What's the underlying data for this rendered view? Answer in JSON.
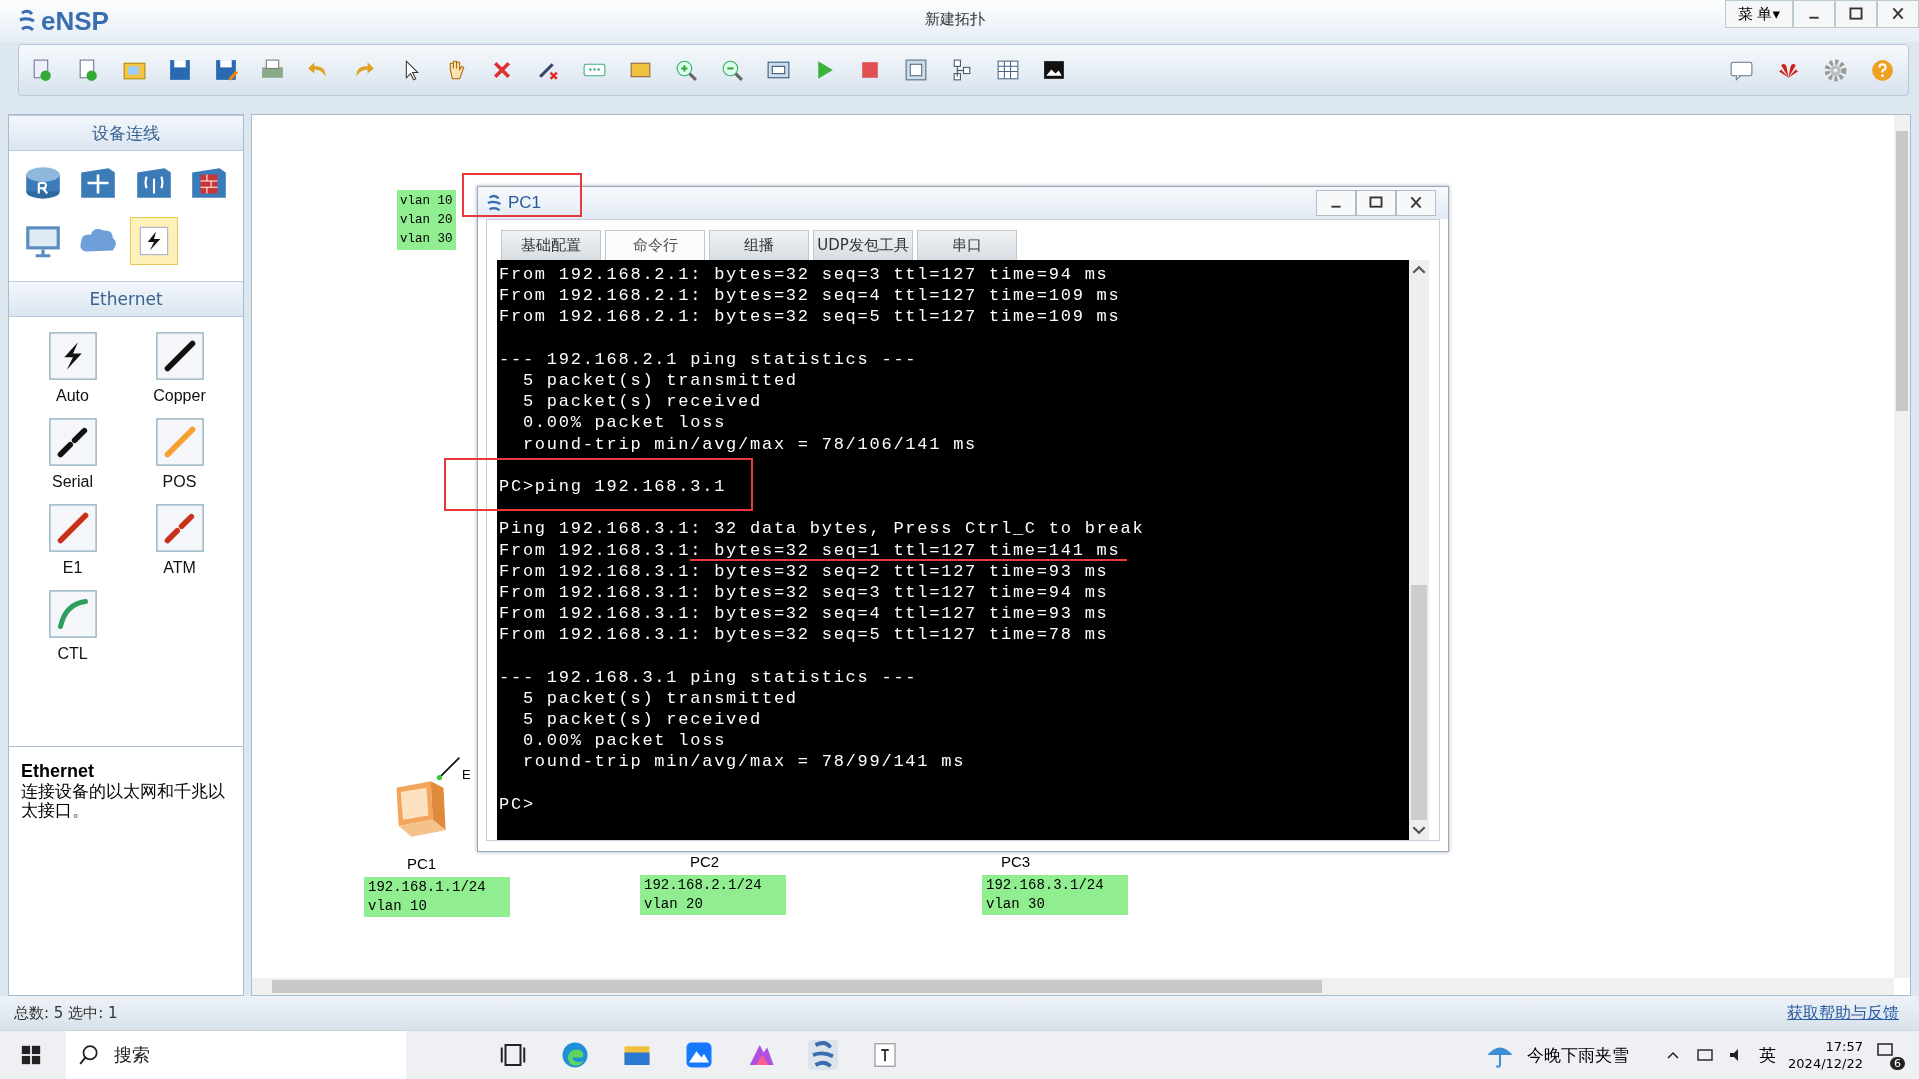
{
  "app": {
    "logo": "eNSP",
    "title": "新建拓扑",
    "menu": "菜 单▾"
  },
  "left_panel": {
    "devices_header": "设备连线",
    "device_types": [
      {
        "kind": "router",
        "selected": false
      },
      {
        "kind": "switch",
        "selected": false
      },
      {
        "kind": "wireless",
        "selected": false
      },
      {
        "kind": "firewall",
        "selected": false
      },
      {
        "kind": "pc",
        "selected": false
      },
      {
        "kind": "cloud",
        "selected": false
      },
      {
        "kind": "cable",
        "selected": true
      }
    ],
    "cables_header": "Ethernet",
    "cables": [
      {
        "label": "Auto",
        "kind": "auto",
        "color": "#111111"
      },
      {
        "label": "Copper",
        "kind": "solid",
        "color": "#111111"
      },
      {
        "label": "Serial",
        "kind": "dashed",
        "color": "#111111"
      },
      {
        "label": "POS",
        "kind": "solid",
        "color": "#f7a032"
      },
      {
        "label": "E1",
        "kind": "solid",
        "color": "#c8321a"
      },
      {
        "label": "ATM",
        "kind": "dashed",
        "color": "#c8321a"
      },
      {
        "label": "CTL",
        "kind": "curve",
        "color": "#2e9e5e"
      }
    ],
    "description": {
      "title": "Ethernet",
      "text": "连接设备的以太网和千兆以太接口。"
    }
  },
  "canvas": {
    "top_label": [
      "vlan 10",
      "vlan 20",
      "vlan 30"
    ],
    "link_label": "E",
    "pcs": [
      {
        "name": "PC1",
        "lines": [
          "192.168.1.1/24",
          "vlan 10"
        ]
      },
      {
        "name": "PC2",
        "lines": [
          "192.168.2.1/24",
          "vlan 20"
        ]
      },
      {
        "name": "PC3",
        "lines": [
          "192.168.3.1/24",
          "vlan 30"
        ]
      }
    ]
  },
  "pc_window": {
    "title": "PC1",
    "tabs": [
      {
        "label": "基础配置",
        "selected": false
      },
      {
        "label": "命令行",
        "selected": true
      },
      {
        "label": "组播",
        "selected": false
      },
      {
        "label": "UDP发包工具",
        "selected": false
      },
      {
        "label": "串口",
        "selected": false
      }
    ],
    "console": [
      [
        "From 192.168.2.1: bytes=32 seq=3 ttl=127 time=94 ms",
        "From 192.168.2.1: bytes=32 seq=4 ttl=127 time=109 ms",
        "From 192.168.2.1: bytes=32 seq=5 ttl=127 time=109 ms"
      ],
      [
        "--- 192.168.2.1 ping statistics ---",
        "  5 packet(s) transmitted",
        "  5 packet(s) received",
        "  0.00% packet loss",
        "  round-trip min/avg/max = 78/106/141 ms"
      ],
      [
        "PC>ping 192.168.3.1"
      ],
      [
        "Ping 192.168.3.1: 32 data bytes, Press Ctrl_C to break",
        "From 192.168.3.1: bytes=32 seq=1 ttl=127 time=141 ms",
        "From 192.168.3.1: bytes=32 seq=2 ttl=127 time=93 ms",
        "From 192.168.3.1: bytes=32 seq=3 ttl=127 time=94 ms",
        "From 192.168.3.1: bytes=32 seq=4 ttl=127 time=93 ms",
        "From 192.168.3.1: bytes=32 seq=5 ttl=127 time=78 ms"
      ],
      [
        "--- 192.168.3.1 ping statistics ---",
        "  5 packet(s) transmitted",
        "  5 packet(s) received",
        "  0.00% packet loss",
        "  round-trip min/avg/max = 78/99/141 ms"
      ],
      [
        "PC>"
      ]
    ]
  },
  "status_bar": {
    "summary": "总数: 5 选中: 1",
    "help_link": "获取帮助与反馈"
  },
  "taskbar": {
    "search": "搜索",
    "weather": "今晚下雨夹雪",
    "ime": "英",
    "time": "17:57",
    "date": "2024/12/22",
    "badge": "6"
  }
}
